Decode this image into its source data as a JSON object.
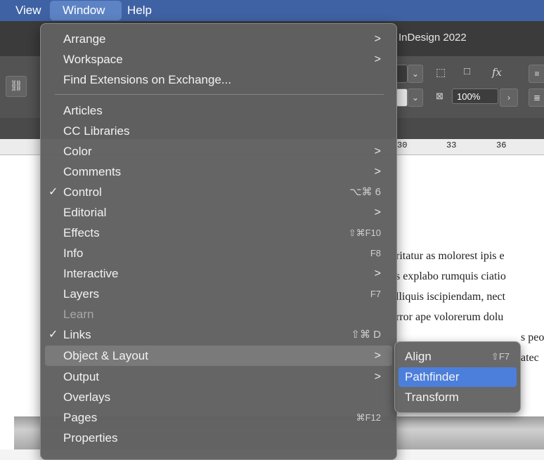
{
  "menubar": {
    "items": [
      "View",
      "Window",
      "Help"
    ]
  },
  "app": {
    "title": "InDesign 2022",
    "zoom": "100%"
  },
  "ruler": {
    "labels": [
      "30",
      "33",
      "36"
    ]
  },
  "document": {
    "lines": [
      "ritatur as molorest ipis e",
      "s explabo rumquis ciatio",
      "lliquis iscipiendam, nect",
      "rror ape volorerum dolu",
      "s peo",
      "atec"
    ]
  },
  "window_menu": {
    "group1": [
      {
        "label": "Arrange",
        "submenu": true
      },
      {
        "label": "Workspace",
        "submenu": true
      },
      {
        "label": "Find Extensions on Exchange..."
      }
    ],
    "group2": [
      {
        "label": "Articles"
      },
      {
        "label": "CC Libraries"
      },
      {
        "label": "Color",
        "submenu": true
      },
      {
        "label": "Comments",
        "submenu": true
      },
      {
        "label": "Control",
        "checked": true,
        "shortcut": "⌥⌘ 6"
      },
      {
        "label": "Editorial",
        "submenu": true
      },
      {
        "label": "Effects",
        "shortcut": "⇧⌘F10"
      },
      {
        "label": "Info",
        "shortcut": "F8"
      },
      {
        "label": "Interactive",
        "submenu": true
      },
      {
        "label": "Layers",
        "shortcut": "F7"
      },
      {
        "label": "Learn",
        "disabled": true
      },
      {
        "label": "Links",
        "checked": true,
        "shortcut": "⇧⌘ D"
      },
      {
        "label": "Object & Layout",
        "submenu": true,
        "highlighted": true
      },
      {
        "label": "Output",
        "submenu": true
      },
      {
        "label": "Overlays"
      },
      {
        "label": "Pages",
        "shortcut": "⌘F12"
      },
      {
        "label": "Properties"
      }
    ],
    "check_glyph": "✓",
    "arrow_glyph": ">"
  },
  "submenu": {
    "items": [
      {
        "label": "Align",
        "shortcut": "⇧F7"
      },
      {
        "label": "Pathfinder",
        "active": true
      },
      {
        "label": "Transform"
      }
    ]
  },
  "colors": {
    "menubar": "#3f62a4",
    "selection": "#4c7fdc"
  }
}
